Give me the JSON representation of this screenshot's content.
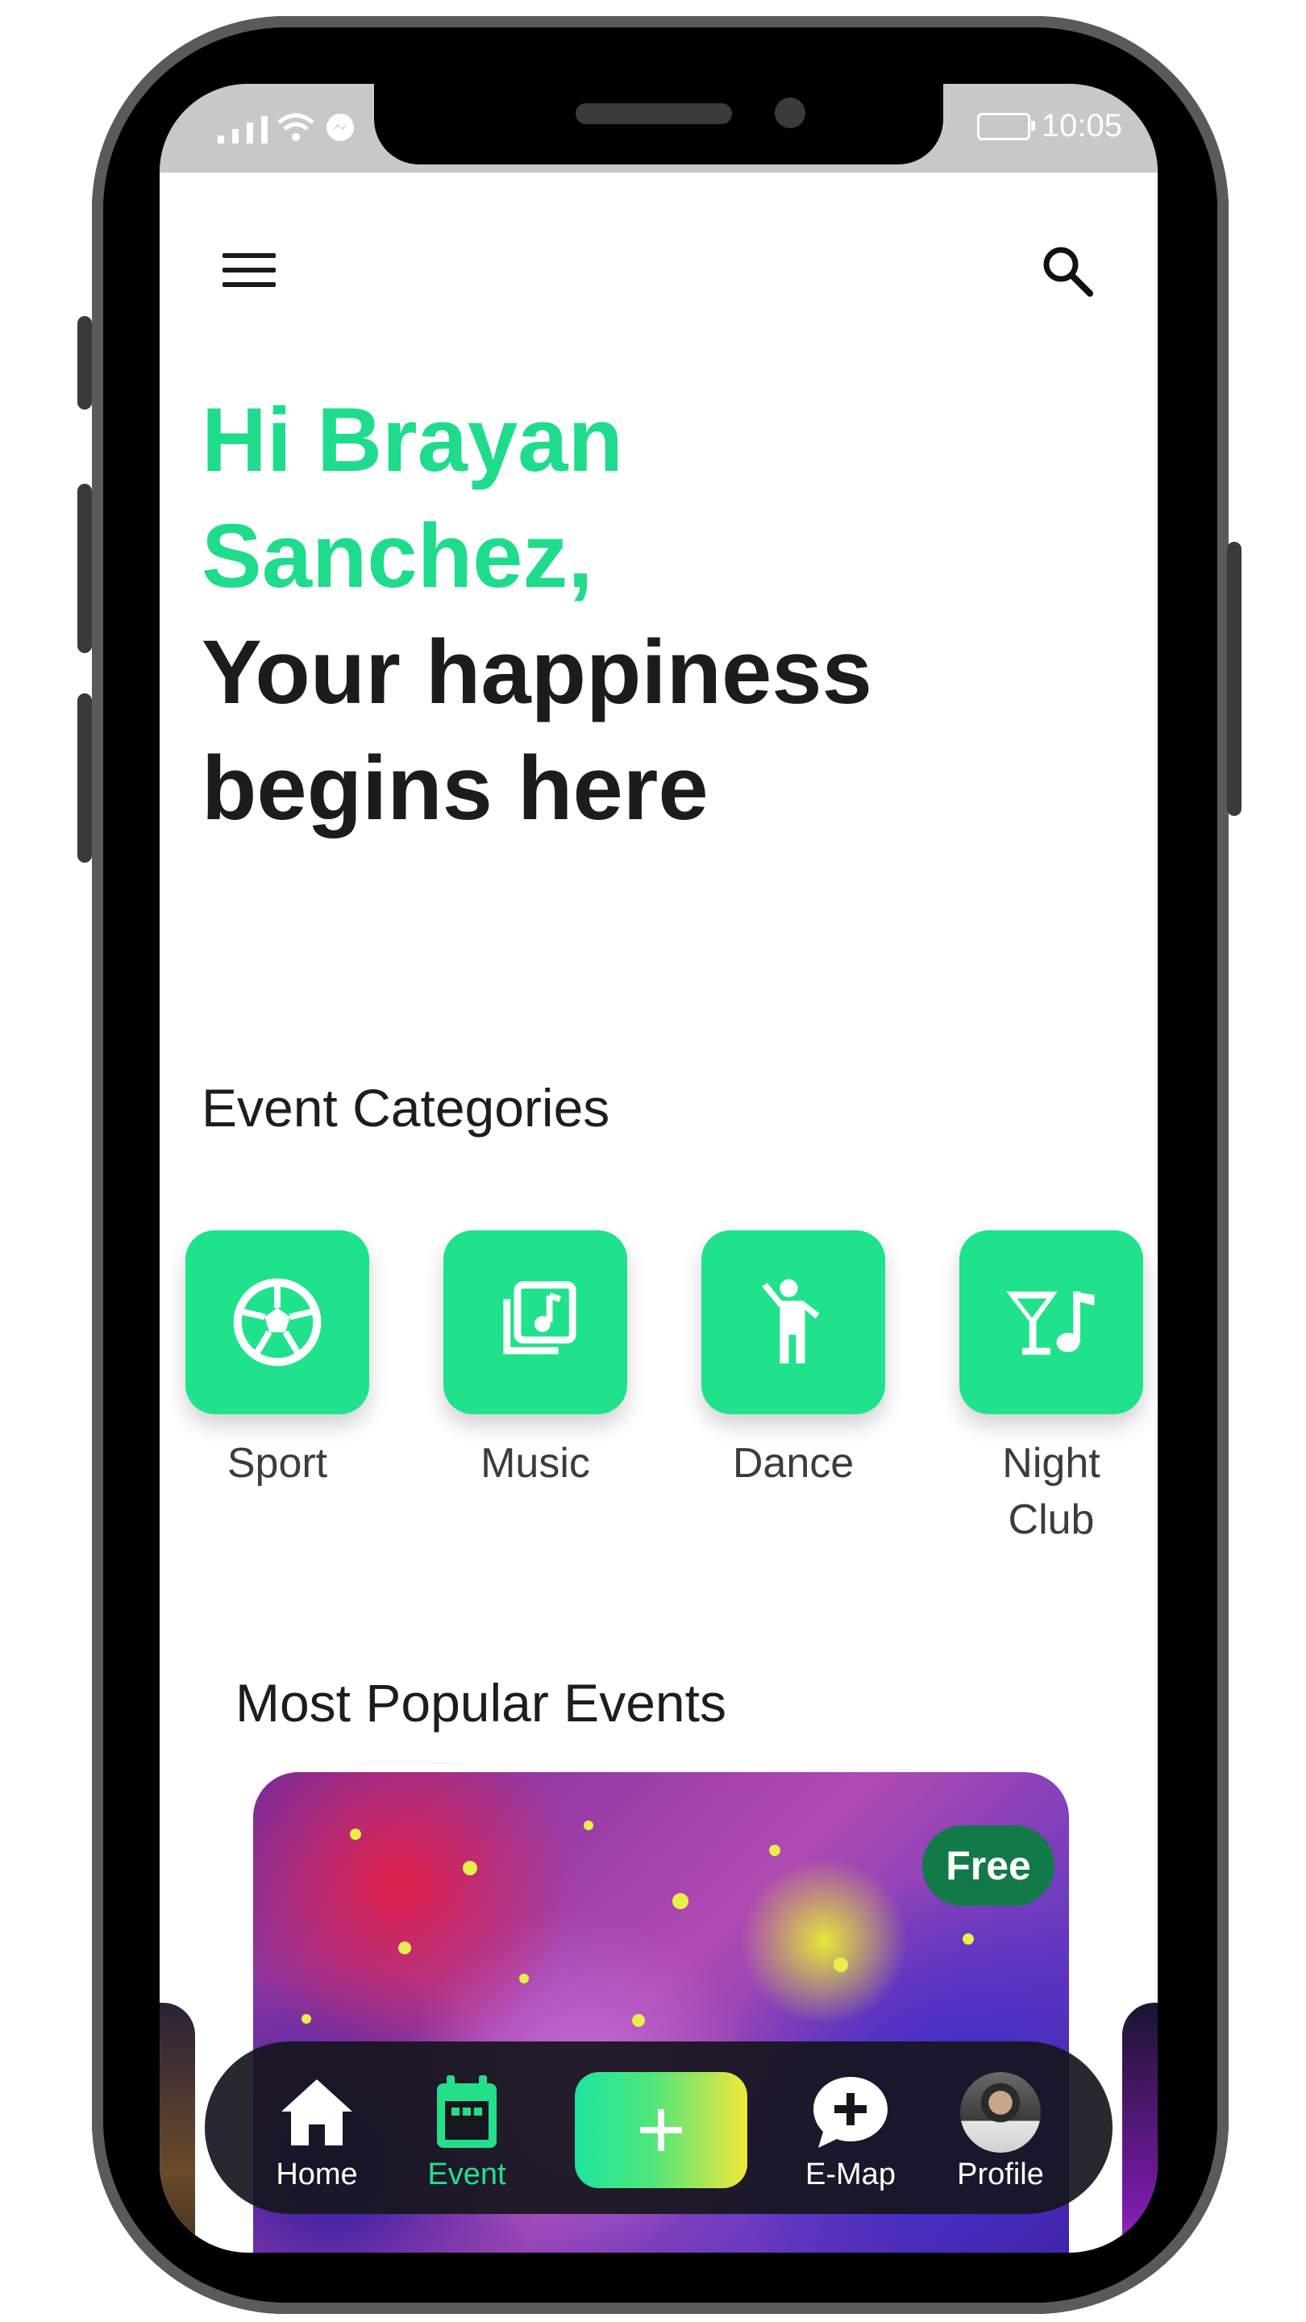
{
  "status_bar": {
    "time": "10:05"
  },
  "header": {
    "menu_icon": "hamburger-menu-icon",
    "search_icon": "search-icon"
  },
  "greeting": {
    "line1": "Hi Brayan",
    "line2": "Sanchez,",
    "line3": "Your happiness",
    "line4": "begins here"
  },
  "categories": {
    "title": "Event Categories",
    "items": [
      {
        "label": "Sport",
        "icon": "soccer-ball-icon"
      },
      {
        "label": "Music",
        "icon": "music-library-icon"
      },
      {
        "label": "Dance",
        "icon": "dancing-person-icon"
      },
      {
        "label_line1": "Night",
        "label_line2": "Club",
        "icon": "cocktail-music-icon"
      }
    ]
  },
  "popular": {
    "title": "Most Popular Events",
    "card": {
      "badge": "Free"
    }
  },
  "bottom_nav": {
    "items": [
      {
        "label": "Home",
        "icon": "home-icon",
        "active": false
      },
      {
        "label": "Event",
        "icon": "calendar-icon",
        "active": true
      },
      {
        "label": "E-Map",
        "icon": "chat-plus-icon",
        "active": false
      },
      {
        "label": "Profile",
        "icon": "avatar",
        "active": false
      }
    ],
    "add_icon": "plus-icon"
  },
  "colors": {
    "accent": "#1fdc8c",
    "badge": "#127a48",
    "nav_bg": "#16161e"
  }
}
